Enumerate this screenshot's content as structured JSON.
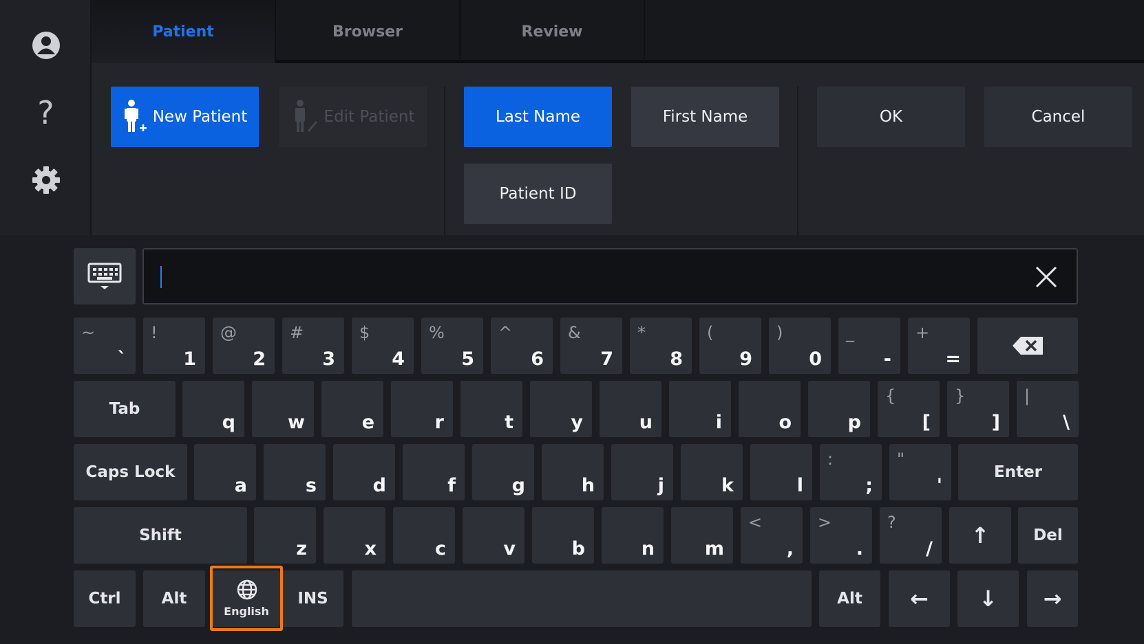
{
  "tabs": [
    {
      "label": "Patient",
      "active": true
    },
    {
      "label": "Browser",
      "active": false
    },
    {
      "label": "Review",
      "active": false
    }
  ],
  "sidebar": {
    "icons": [
      "user-icon",
      "help-icon",
      "settings-icon"
    ]
  },
  "actions": {
    "new_patient": "New Patient",
    "edit_patient": "Edit Patient"
  },
  "search_fields": {
    "last_name": "Last Name",
    "first_name": "First Name",
    "patient_id": "Patient ID"
  },
  "dialog": {
    "ok": "OK",
    "cancel": "Cancel"
  },
  "input": {
    "value": ""
  },
  "keyboard": {
    "row1": [
      {
        "s": "~",
        "p": "`"
      },
      {
        "s": "!",
        "p": "1"
      },
      {
        "s": "@",
        "p": "2"
      },
      {
        "s": "#",
        "p": "3"
      },
      {
        "s": "$",
        "p": "4"
      },
      {
        "s": "%",
        "p": "5"
      },
      {
        "s": "^",
        "p": "6"
      },
      {
        "s": "&",
        "p": "7"
      },
      {
        "s": "*",
        "p": "8"
      },
      {
        "s": "(",
        "p": "9"
      },
      {
        "s": ")",
        "p": "0"
      },
      {
        "s": "_",
        "p": "-"
      },
      {
        "s": "+",
        "p": "="
      }
    ],
    "row2": [
      {
        "p": "q"
      },
      {
        "p": "w"
      },
      {
        "p": "e"
      },
      {
        "p": "r"
      },
      {
        "p": "t"
      },
      {
        "p": "y"
      },
      {
        "p": "u"
      },
      {
        "p": "i"
      },
      {
        "p": "o"
      },
      {
        "p": "p"
      },
      {
        "s": "{",
        "p": "["
      },
      {
        "s": "}",
        "p": "]"
      },
      {
        "s": "|",
        "p": "\\"
      }
    ],
    "row3": [
      {
        "p": "a"
      },
      {
        "p": "s"
      },
      {
        "p": "d"
      },
      {
        "p": "f"
      },
      {
        "p": "g"
      },
      {
        "p": "h"
      },
      {
        "p": "j"
      },
      {
        "p": "k"
      },
      {
        "p": "l"
      },
      {
        "s": ":",
        "p": ";"
      },
      {
        "s": "\"",
        "p": "'"
      }
    ],
    "row4": [
      {
        "p": "z"
      },
      {
        "p": "x"
      },
      {
        "p": "c"
      },
      {
        "p": "v"
      },
      {
        "p": "b"
      },
      {
        "p": "n"
      },
      {
        "p": "m"
      },
      {
        "s": "<",
        "p": ","
      },
      {
        "s": ">",
        "p": "."
      },
      {
        "s": "?",
        "p": "/"
      }
    ],
    "tab": "Tab",
    "caps": "Caps Lock",
    "enter": "Enter",
    "shift": "Shift",
    "del": "Del",
    "ctrl": "Ctrl",
    "alt": "Alt",
    "alt_right": "Alt",
    "ins": "INS",
    "language": "English",
    "arrow_up": "↑",
    "arrow_left": "←",
    "arrow_down": "↓",
    "arrow_right": "→"
  },
  "colors": {
    "accent": "#0a62e0",
    "highlight": "#f07a12"
  }
}
